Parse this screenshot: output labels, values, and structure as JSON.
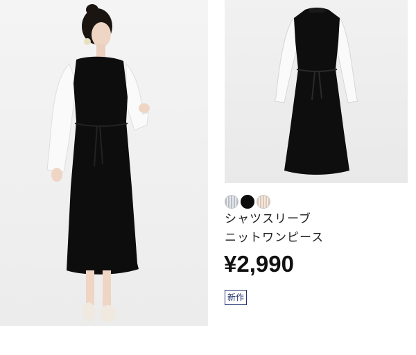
{
  "product": {
    "name_line1": "シャツスリーブ",
    "name_line2": "ニットワンピース",
    "price": "¥2,990",
    "badge": "新作"
  },
  "images": {
    "model_photo": "model-wearing-dress-photo",
    "flat_photo": "dress-flat-lay-photo"
  },
  "swatches": [
    {
      "name": "gray",
      "color": "#b8bcc6"
    },
    {
      "name": "black",
      "color": "#0c0c0c"
    },
    {
      "name": "beige",
      "color": "#dcc8b8"
    }
  ]
}
